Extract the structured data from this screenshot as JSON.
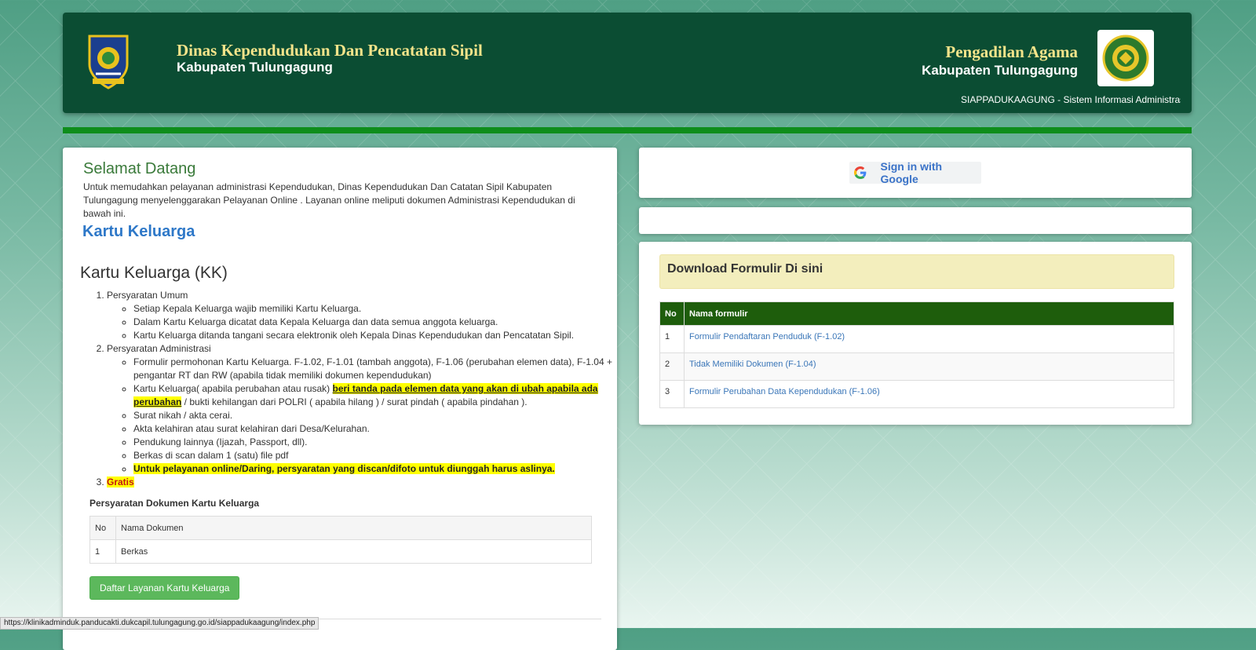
{
  "header": {
    "left_title": "Dinas Kependudukan Dan Pencatatan Sipil",
    "left_subtitle": "Kabupaten Tulungagung",
    "right_title": "Pengadilan Agama",
    "right_subtitle": "Kabupaten Tulungagung",
    "marquee_text": "SIAPPADUKAAGUNG - Sistem Informasi Administrasi",
    "left_logo_icon": "tulungagung-regency-logo",
    "right_logo_icon": "pengadilan-agama-logo"
  },
  "welcome": {
    "title": "Selamat Datang",
    "text": "Untuk memudahkan pelayanan administrasi Kependudukan, Dinas Kependudukan Dan Catatan Sipil Kabupaten Tulungagung menyelenggarakan Pelayanan Online . Layanan online meliputi dokumen Administrasi Kependudukan di bawah ini."
  },
  "service": {
    "heading": "Kartu Keluarga",
    "subheading": "Kartu Keluarga (KK)",
    "requirements": [
      {
        "label": "Persyaratan Umum",
        "items": [
          "Setiap Kepala Keluarga wajib memiliki Kartu Keluarga.",
          "Dalam Kartu Keluarga dicatat data Kepala Keluarga dan data semua anggota keluarga.",
          "Kartu Keluarga ditanda tangani secara elektronik oleh Kepala Dinas Kependudukan dan Pencatatan Sipil."
        ]
      },
      {
        "label": "Persyaratan Administrasi",
        "items_before": [
          "Formulir permohonan Kartu Keluarga. F-1.02, F-1.01 (tambah anggota), F-1.06 (perubahan elemen data), F-1.04 + pengantar RT dan RW (apabila tidak memiliki dokumen kependudukan)"
        ],
        "kk_item_prefix": "Kartu Keluarga( apabila perubahan atau rusak) ",
        "kk_item_highlight": "beri tanda pada elemen data yang akan di ubah apabila ada perubahan",
        "kk_item_suffix": " / bukti kehilangan dari POLRI ( apabila hilang ) / surat pindah ( apabila pindahan ).",
        "items_after": [
          "Surat nikah / akta cerai.",
          "Akta kelahiran atau surat kelahiran dari Desa/Kelurahan.",
          "Pendukung lainnya (Ijazah, Passport, dll).",
          "Berkas di scan dalam 1 (satu) file pdf"
        ],
        "online_note": "Untuk pelayanan online/Daring, persyaratan yang discan/difoto untuk diunggah harus aslinya."
      },
      {
        "label": "Gratis"
      }
    ],
    "docs_title": "Persyaratan Dokumen Kartu Keluarga",
    "docs_headers": [
      "No",
      "Nama Dokumen"
    ],
    "docs_rows": [
      [
        "1",
        "Berkas"
      ]
    ],
    "register_button": "Daftar Layanan Kartu Keluarga"
  },
  "signin": {
    "label": "Sign in with Google",
    "icon": "google-g-icon"
  },
  "download": {
    "title": "Download Formulir Di sini",
    "headers": [
      "No",
      "Nama formulir"
    ],
    "rows": [
      [
        "1",
        "Formulir Pendaftaran Penduduk (F-1.02)"
      ],
      [
        "2",
        "Tidak Memiliki Dokumen (F-1.04)"
      ],
      [
        "3",
        "Formulir Perubahan Data Kependudukan (F-1.06)"
      ]
    ]
  },
  "status_bar": {
    "url": "https://klinikadminduk.panducakti.dukcapil.tulungagung.go.id/siappadukaagung/index.php"
  },
  "colors": {
    "header_bg": "#0b4d33",
    "accent_bar": "#0e8d1b",
    "header_gold": "#f4e48a",
    "table_header": "#1e5d0c",
    "button_green": "#5cb85c",
    "link_blue": "#3a76b8"
  }
}
